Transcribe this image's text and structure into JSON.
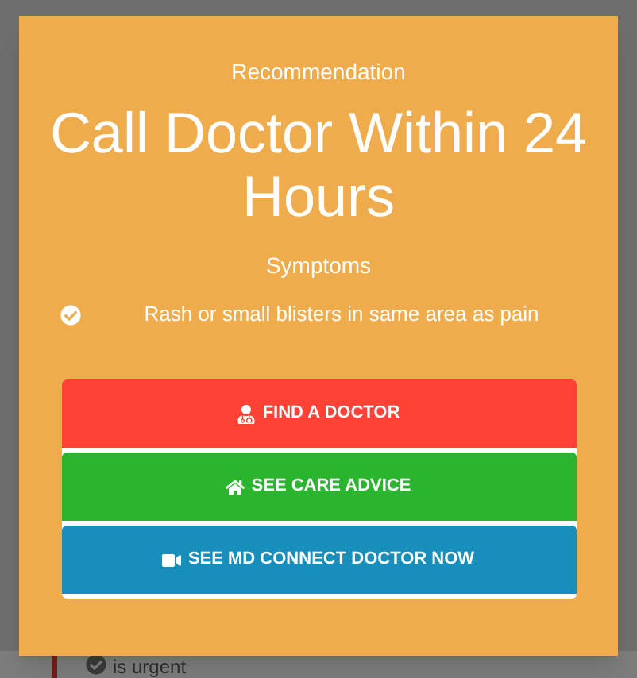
{
  "background": {
    "text": "is urgent"
  },
  "modal": {
    "eyebrow": "Recommendation",
    "title": "Call Doctor Within 24 Hours",
    "symptoms_heading": "Symptoms",
    "symptoms": [
      {
        "text": "Rash or small blisters in same area as pain",
        "checked": true
      }
    ],
    "actions": [
      {
        "label": "FIND A DOCTOR",
        "kind": "doctor",
        "color": "#ff4136"
      },
      {
        "label": "SEE CARE ADVICE",
        "kind": "home",
        "color": "#2bb52f"
      },
      {
        "label": "SEE MD CONNECT DOCTOR NOW",
        "kind": "video",
        "color": "#188ebb"
      }
    ]
  }
}
